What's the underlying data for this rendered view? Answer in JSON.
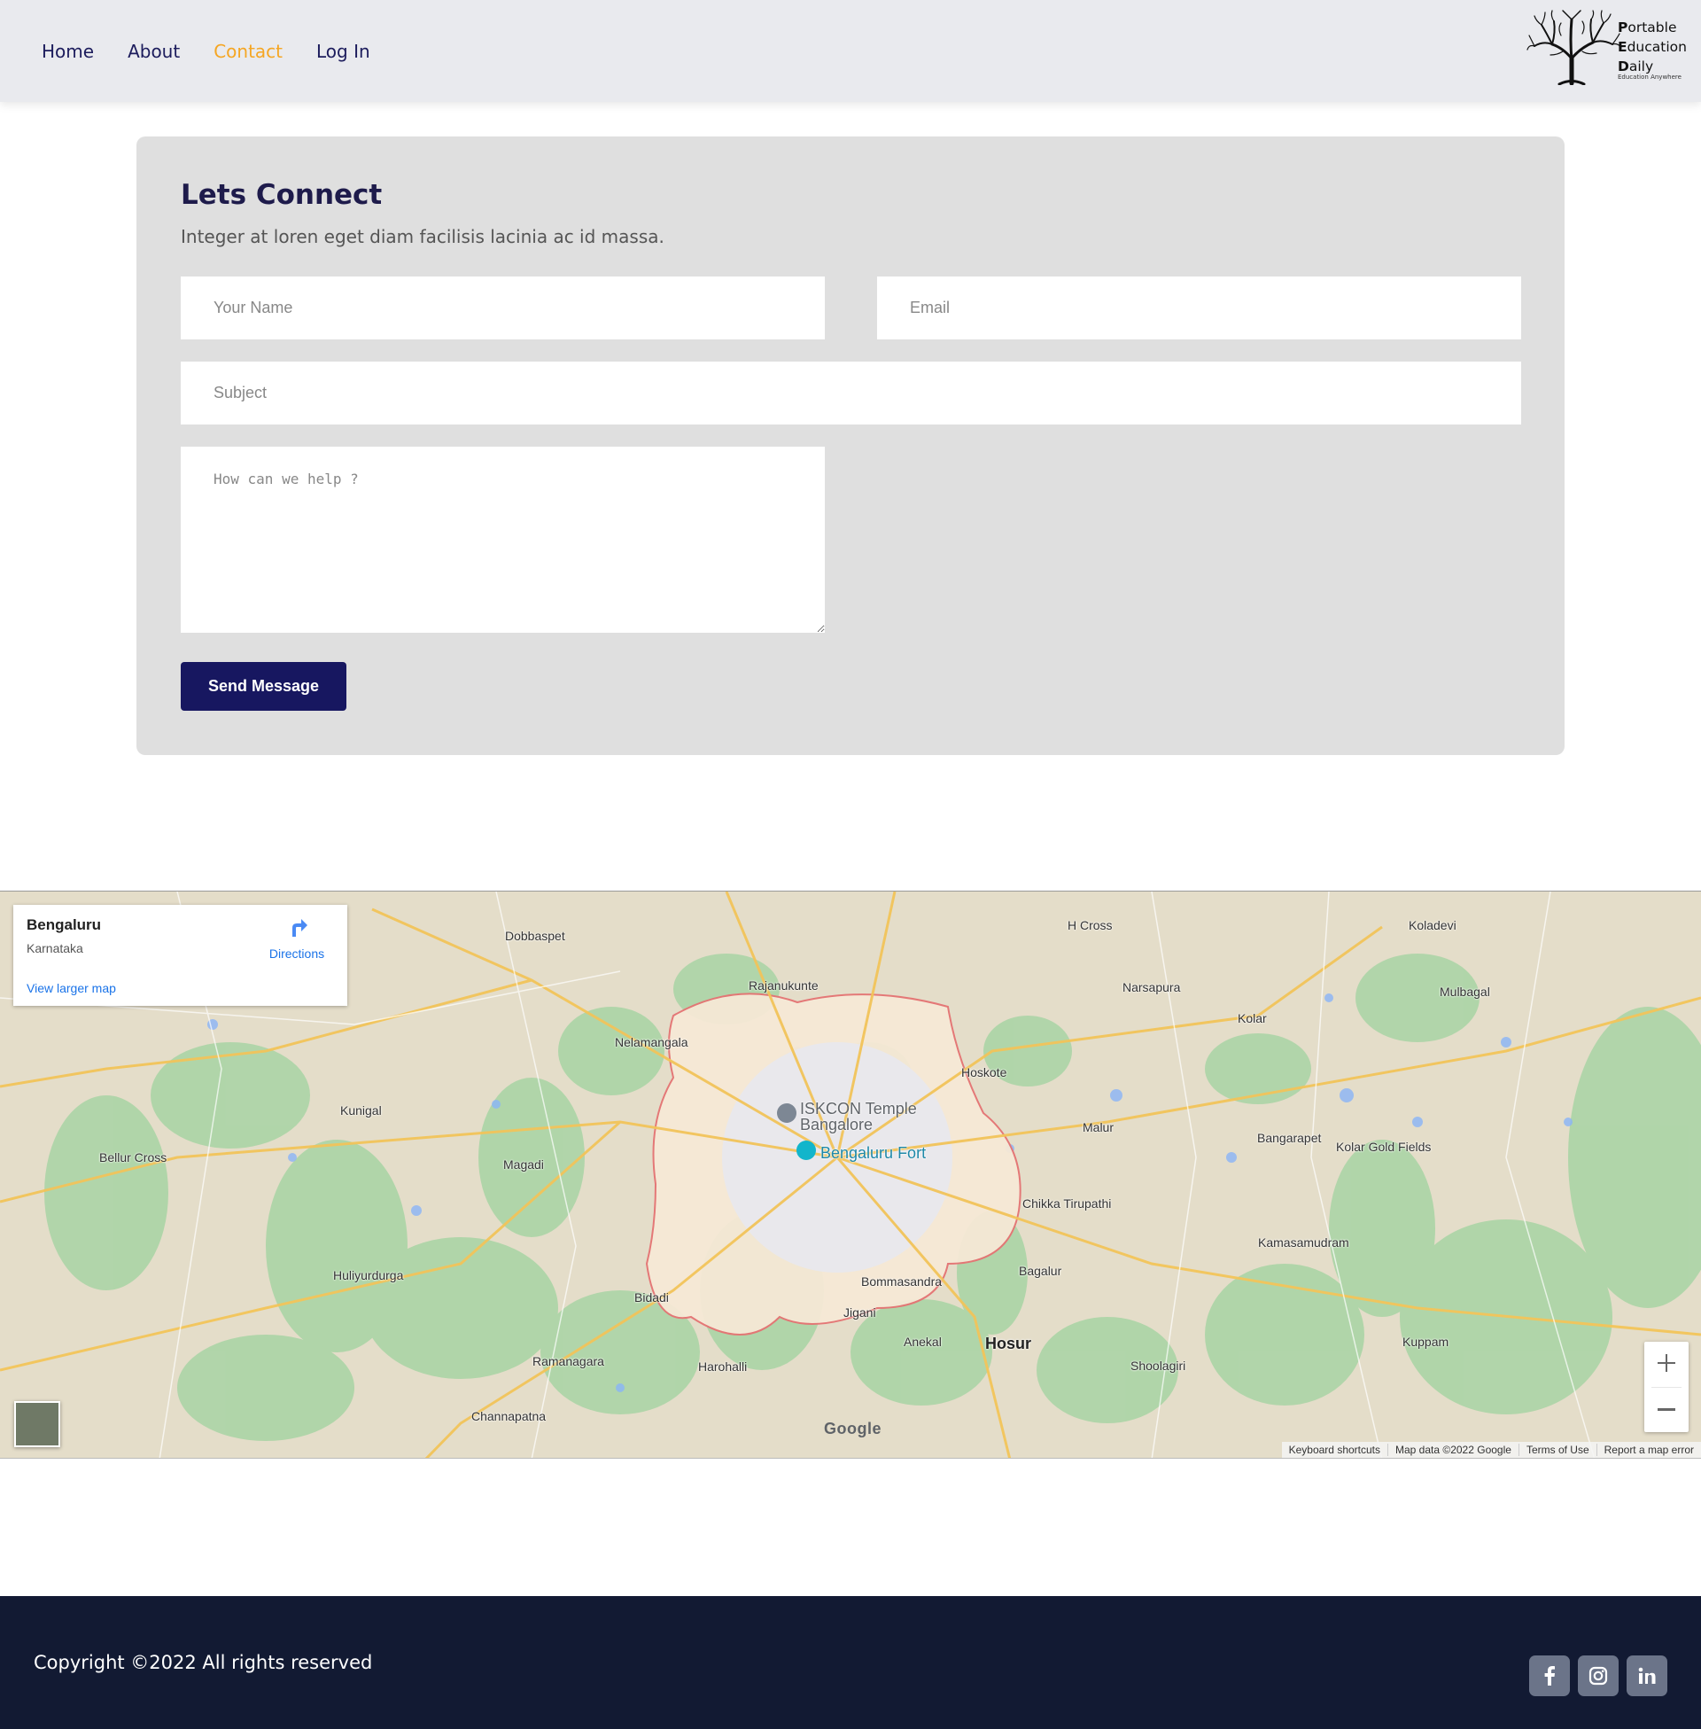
{
  "nav": {
    "items": [
      {
        "label": "Home",
        "active": false
      },
      {
        "label": "About",
        "active": false
      },
      {
        "label": "Contact",
        "active": true
      },
      {
        "label": "Log In",
        "active": false
      }
    ],
    "active_color": "#f5a623",
    "link_color": "#1c1c5c"
  },
  "logo": {
    "line1_initial": "P",
    "line1_rest": "ortable",
    "line2_initial": "E",
    "line2_rest": "ducation",
    "line3_initial": "D",
    "line3_rest": "aily",
    "tagline": "Education Anywhere"
  },
  "contact": {
    "title": "Lets Connect",
    "subtitle": "Integer at loren eget diam facilisis lacinia ac id massa.",
    "name_placeholder": "Your Name",
    "email_placeholder": "Email",
    "subject_placeholder": "Subject",
    "message_placeholder": "How can we help ?",
    "send_label": "Send Message",
    "button_color": "#171760"
  },
  "map": {
    "place_title": "Bengaluru",
    "place_region": "Karnataka",
    "directions_label": "Directions",
    "larger_map_label": "View larger map",
    "labels": {
      "iskcon_1": "ISKCON Temple",
      "iskcon_2": "Bangalore",
      "fort": "Bengaluru Fort",
      "nelamangala": "Nelamangala",
      "hoskote": "Hoskote",
      "kolar": "Kolar",
      "hosur": "Hosur",
      "bidadi": "Bidadi",
      "magadi": "Magadi",
      "ramanagara": "Ramanagara",
      "channapatna": "Channapatna",
      "anekal": "Anekal",
      "malur": "Malur",
      "dobbaspet": "Dobbaspet",
      "kunigal": "Kunigal",
      "chikka_tirupathi": "Chikka Tirupathi",
      "bommasandra": "Bommasandra",
      "rajanukunte": "Rajanukunte",
      "bangarapet": "Bangarapet",
      "kolar_gold_fields": "Kolar Gold Fields",
      "kamasamudram": "Kamasamudram",
      "hulyurdurga": "Huliyurdurga",
      "bellur_cross": "Bellur Cross",
      "harohalli": "Harohalli",
      "jigani": "Jigani",
      "bagalur": "Bagalur",
      "shoolagiri": "Shoolagiri",
      "kuppam": "Kuppam",
      "mulbagal": "Mulbagal",
      "koladevi": "Koladevi",
      "h_cross": "H Cross",
      "narsapura": "Narsapura"
    },
    "google_label": "Google",
    "footer": {
      "shortcuts": "Keyboard shortcuts",
      "map_data": "Map data ©2022 Google",
      "terms": "Terms of Use",
      "report": "Report a map error"
    }
  },
  "footer": {
    "copyright": "Copyright ©2022 All rights reserved",
    "social": [
      {
        "name": "facebook",
        "icon": "facebook-icon"
      },
      {
        "name": "instagram",
        "icon": "instagram-icon"
      },
      {
        "name": "linkedin",
        "icon": "linkedin-icon"
      }
    ]
  }
}
